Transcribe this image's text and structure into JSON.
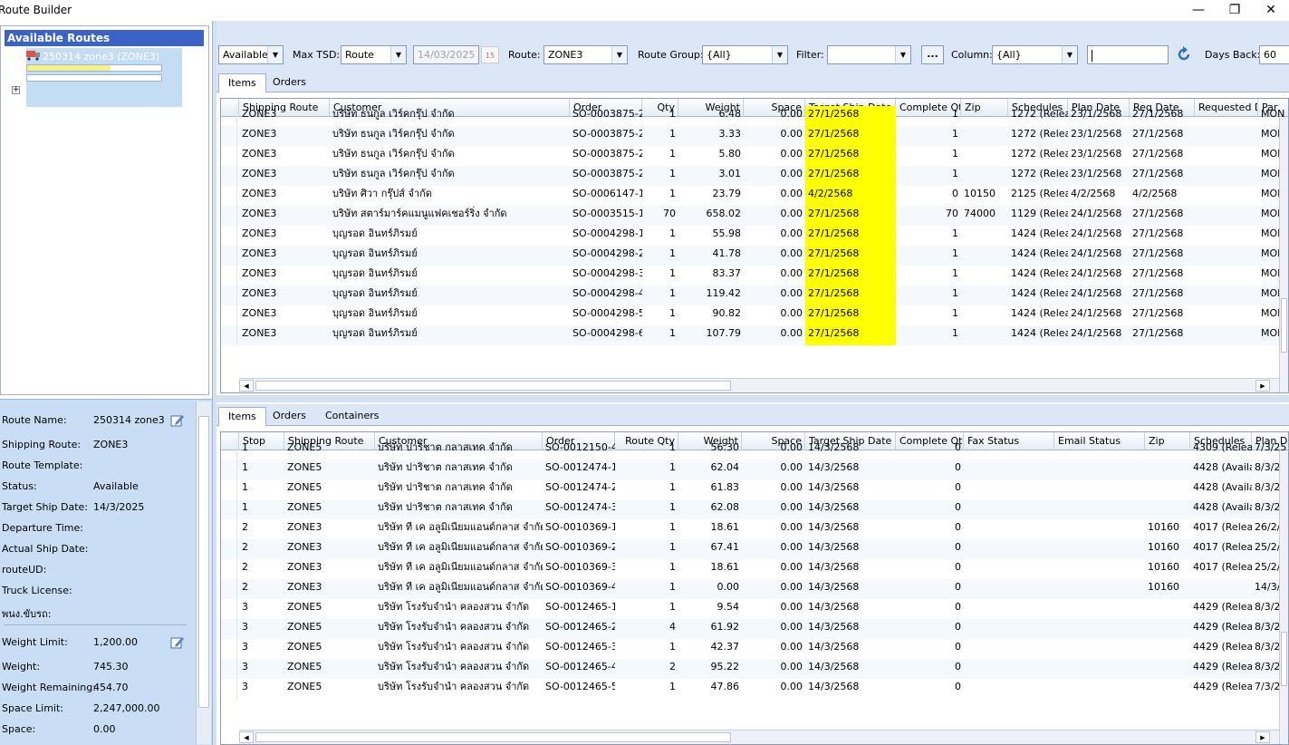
{
  "window": {
    "title": "Route Builder",
    "minimize": "—",
    "maximize": "❐",
    "close": "✕"
  },
  "left": {
    "header": "Available Routes",
    "route_node_label": "250314 zone3 (ZONE3)",
    "weight_fill_fraction": 0.62,
    "expander": "+"
  },
  "details": [
    {
      "label": "Route Name:",
      "value": "250314 zone3"
    },
    {
      "label": "Shipping Route:",
      "value": "ZONE3"
    },
    {
      "label": "Route Template:",
      "value": ""
    },
    {
      "label": "Status:",
      "value": "Available"
    },
    {
      "label": "Target Ship Date:",
      "value": "14/3/2025"
    },
    {
      "label": "Departure Time:",
      "value": ""
    },
    {
      "label": "Actual Ship Date:",
      "value": ""
    },
    {
      "label": "routeUD:",
      "value": ""
    },
    {
      "label": "Truck License:",
      "value": ""
    },
    {
      "label": "พนง.ขับรถ:",
      "value": ""
    },
    {
      "label": "Weight Limit:",
      "value": "1,200.00"
    },
    {
      "label": "Weight:",
      "value": "745.30"
    },
    {
      "label": "Weight Remaining:",
      "value": "454.70"
    },
    {
      "label": "Space Limit:",
      "value": "2,247,000.00"
    },
    {
      "label": "Space:",
      "value": "0.00"
    }
  ],
  "toolbar": {
    "status_value": "Available",
    "max_tsd_label": "Max TSD:",
    "max_tsd_value": "Route",
    "date_value": "14/03/2025",
    "cal_icon": "15",
    "route_label": "Route:",
    "route_value": "ZONE3",
    "route_group_label": "Route Group:",
    "route_group_value": "{All}",
    "filter_label": "Filter:",
    "filter_value": "",
    "dots_label": "...",
    "column_label": "Column:",
    "column_value": "{All}",
    "search_value": "",
    "days_back_label": "Days Back:",
    "days_back_value": "60"
  },
  "top_tabs": [
    "Items",
    "Orders"
  ],
  "bottom_tabs": [
    "Items",
    "Orders",
    "Containers"
  ],
  "top_grid": {
    "columns": [
      "Shipping Route",
      "Customer",
      "Order",
      "Qty",
      "Weight",
      "Space",
      "Target Ship Date",
      "Complete Qty",
      "Zip",
      "Schedules",
      "Plan Date",
      "Req Date",
      "Requested D",
      "Par"
    ],
    "rows": [
      [
        "ZONE3",
        "บริษัท ธนกูล เวิร์คกรุ๊ป  จำกัด",
        "SO-0003875-23",
        "1",
        "6.48",
        "0.00",
        "27/1/2568",
        "1",
        "",
        "1272 (Releas",
        "23/1/2568",
        "27/1/2568",
        "",
        "MON"
      ],
      [
        "ZONE3",
        "บริษัท ธนกูล เวิร์คกรุ๊ป  จำกัด",
        "SO-0003875-24",
        "1",
        "3.33",
        "0.00",
        "27/1/2568",
        "1",
        "",
        "1272 (Releas",
        "23/1/2568",
        "27/1/2568",
        "",
        "MON"
      ],
      [
        "ZONE3",
        "บริษัท ธนกูล เวิร์คกรุ๊ป  จำกัด",
        "SO-0003875-25",
        "1",
        "5.80",
        "0.00",
        "27/1/2568",
        "1",
        "",
        "1272 (Releas",
        "23/1/2568",
        "27/1/2568",
        "",
        "MON"
      ],
      [
        "ZONE3",
        "บริษัท ธนกูล เวิร์คกรุ๊ป  จำกัด",
        "SO-0003875-26",
        "1",
        "3.01",
        "0.00",
        "27/1/2568",
        "1",
        "",
        "1272 (Releas",
        "23/1/2568",
        "27/1/2568",
        "",
        "MON"
      ],
      [
        "ZONE3",
        "บริษัท ศิวา กรุ๊ปส์  จำกัด",
        "SO-0006147-1",
        "1",
        "23.79",
        "0.00",
        "4/2/2568",
        "0",
        "10150",
        "2125 (Releas",
        "4/2/2568",
        "4/2/2568",
        "",
        "MON"
      ],
      [
        "ZONE3",
        "บริษัท สตาร์มาร์คแมนูแฟคเชอร์ริ่ง  จำกัด",
        "SO-0003515-1",
        "70",
        "658.02",
        "0.00",
        "27/1/2568",
        "70",
        "74000",
        "1129 (Releas",
        "24/1/2568",
        "27/1/2568",
        "",
        "MON"
      ],
      [
        "ZONE3",
        "บุญรอด อินทร์ภิรมย์",
        "SO-0004298-1",
        "1",
        "55.98",
        "0.00",
        "27/1/2568",
        "1",
        "",
        "1424 (Releas",
        "24/1/2568",
        "27/1/2568",
        "",
        "MON"
      ],
      [
        "ZONE3",
        "บุญรอด อินทร์ภิรมย์",
        "SO-0004298-2",
        "1",
        "41.78",
        "0.00",
        "27/1/2568",
        "1",
        "",
        "1424 (Releas",
        "24/1/2568",
        "27/1/2568",
        "",
        "MON"
      ],
      [
        "ZONE3",
        "บุญรอด อินทร์ภิรมย์",
        "SO-0004298-3",
        "1",
        "83.37",
        "0.00",
        "27/1/2568",
        "1",
        "",
        "1424 (Releas",
        "24/1/2568",
        "27/1/2568",
        "",
        "MON"
      ],
      [
        "ZONE3",
        "บุญรอด อินทร์ภิรมย์",
        "SO-0004298-4",
        "1",
        "119.42",
        "0.00",
        "27/1/2568",
        "1",
        "",
        "1424 (Releas",
        "24/1/2568",
        "27/1/2568",
        "",
        "MON"
      ],
      [
        "ZONE3",
        "บุญรอด อินทร์ภิรมย์",
        "SO-0004298-5",
        "1",
        "90.82",
        "0.00",
        "27/1/2568",
        "1",
        "",
        "1424 (Releas",
        "24/1/2568",
        "27/1/2568",
        "",
        "MON"
      ],
      [
        "ZONE3",
        "บุญรอด อินทร์ภิรมย์",
        "SO-0004298-6",
        "1",
        "107.79",
        "0.00",
        "27/1/2568",
        "1",
        "",
        "1424 (Releas",
        "24/1/2568",
        "27/1/2568",
        "",
        "MON"
      ]
    ],
    "highlight_color": "#ffff00"
  },
  "bottom_grid": {
    "columns": [
      "Stop",
      "Shipping Route",
      "Customer",
      "Order",
      "Route Qty",
      "Weight",
      "Space",
      "Target Ship Date",
      "Complete Qty",
      "Fax Status",
      "Email Status",
      "Zip",
      "Schedules",
      "Plan D"
    ],
    "rows": [
      [
        "1",
        "ZONE5",
        "บริษัท ปาริชาต กลาสเทค  จำกัด",
        "SO-0012150-4",
        "1",
        "56.30",
        "0.00",
        "14/3/2568",
        "0",
        "",
        "",
        "",
        "4309 (Releas",
        "7/3/25"
      ],
      [
        "1",
        "ZONE5",
        "บริษัท ปาริชาต กลาสเทค  จำกัด",
        "SO-0012474-1",
        "1",
        "62.04",
        "0.00",
        "14/3/2568",
        "0",
        "",
        "",
        "",
        "4428 (Availal",
        "8/3/25"
      ],
      [
        "1",
        "ZONE5",
        "บริษัท ปาริชาต กลาสเทค  จำกัด",
        "SO-0012474-2",
        "1",
        "61.83",
        "0.00",
        "14/3/2568",
        "0",
        "",
        "",
        "",
        "4428 (Availal",
        "8/3/25"
      ],
      [
        "1",
        "ZONE5",
        "บริษัท ปาริชาต กลาสเทค  จำกัด",
        "SO-0012474-3",
        "1",
        "62.08",
        "0.00",
        "14/3/2568",
        "0",
        "",
        "",
        "",
        "4428 (Availal",
        "8/3/25"
      ],
      [
        "2",
        "ZONE3",
        "บริษัท ที เค อลูมิเนียมแอนด์กลาส จำกัด",
        "SO-0010369-1",
        "1",
        "18.61",
        "0.00",
        "14/3/2568",
        "0",
        "",
        "",
        "10160",
        "4017 (Releas",
        "26/2/2"
      ],
      [
        "2",
        "ZONE3",
        "บริษัท ที เค อลูมิเนียมแอนด์กลาส จำกัด",
        "SO-0010369-2",
        "1",
        "67.41",
        "0.00",
        "14/3/2568",
        "0",
        "",
        "",
        "10160",
        "4017 (Releas",
        "25/2/2"
      ],
      [
        "2",
        "ZONE3",
        "บริษัท ที เค อลูมิเนียมแอนด์กลาส จำกัด",
        "SO-0010369-3",
        "1",
        "18.61",
        "0.00",
        "14/3/2568",
        "0",
        "",
        "",
        "10160",
        "4017 (Releas",
        "25/2/2"
      ],
      [
        "2",
        "ZONE3",
        "บริษัท ที เค อลูมิเนียมแอนด์กลาส จำกัด",
        "SO-0010369-4",
        "1",
        "0.00",
        "0.00",
        "14/3/2568",
        "0",
        "",
        "",
        "10160",
        "",
        "14/3/2"
      ],
      [
        "3",
        "ZONE5",
        "บริษัท โรงรับจำนำ คลองสวน จำกัด",
        "SO-0012465-1",
        "1",
        "9.54",
        "0.00",
        "14/3/2568",
        "0",
        "",
        "",
        "",
        "4429 (Releas",
        "8/3/25"
      ],
      [
        "3",
        "ZONE5",
        "บริษัท โรงรับจำนำ คลองสวน จำกัด",
        "SO-0012465-2",
        "4",
        "61.92",
        "0.00",
        "14/3/2568",
        "0",
        "",
        "",
        "",
        "4429 (Releas",
        "8/3/25"
      ],
      [
        "3",
        "ZONE5",
        "บริษัท โรงรับจำนำ คลองสวน จำกัด",
        "SO-0012465-3",
        "1",
        "42.37",
        "0.00",
        "14/3/2568",
        "0",
        "",
        "",
        "",
        "4429 (Releas",
        "8/3/25"
      ],
      [
        "3",
        "ZONE5",
        "บริษัท โรงรับจำนำ คลองสวน จำกัด",
        "SO-0012465-4",
        "2",
        "95.22",
        "0.00",
        "14/3/2568",
        "0",
        "",
        "",
        "",
        "4429 (Releas",
        "8/3/25"
      ],
      [
        "3",
        "ZONE5",
        "บริษัท โรงรับจำนำ คลองสวน จำกัด",
        "SO-0012465-5",
        "1",
        "47.86",
        "0.00",
        "14/3/2568",
        "0",
        "",
        "",
        "",
        "4429 (Releas",
        "7/3/25"
      ]
    ]
  }
}
